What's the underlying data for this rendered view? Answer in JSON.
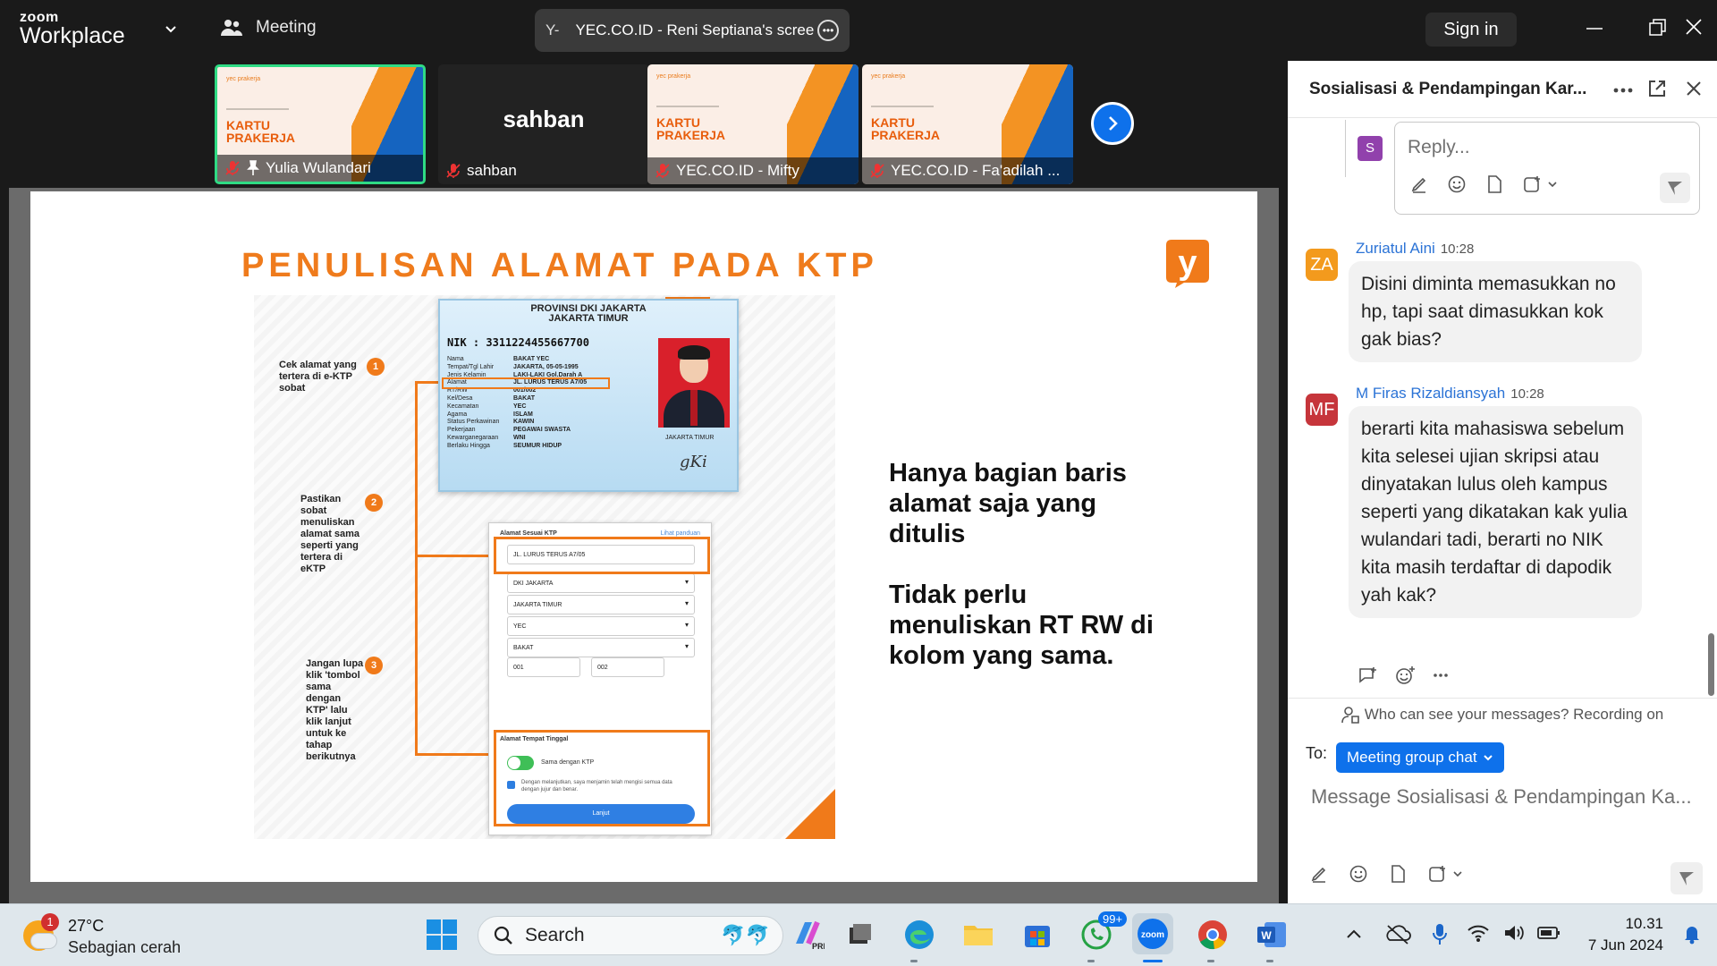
{
  "app": {
    "logo_top": "zoom",
    "logo_bottom": "Workplace",
    "meeting_label": "Meeting",
    "share_prefix": "Y-",
    "share_title": "YEC.CO.ID - Reni Septiana's scree",
    "signin": "Sign in"
  },
  "participants": [
    {
      "name": "Yulia Wulandari",
      "type": "slide",
      "active": true
    },
    {
      "name": "sahban",
      "type": "name"
    },
    {
      "name": "YEC.CO.ID - Mifty",
      "type": "slide"
    },
    {
      "name": "YEC.CO.ID - Fa'adilah ...",
      "type": "slide"
    }
  ],
  "thumb": {
    "brand": "yec prakerja",
    "title1": "KARTU",
    "title2": "PRAKERJA"
  },
  "slide": {
    "title": "PENULISAN ALAMAT PADA KTP",
    "logo": "y",
    "ktp": {
      "province": "PROVINSI DKI JAKARTA",
      "city": "JAKARTA TIMUR",
      "nik_label": "NIK",
      "nik": "3311224455667700",
      "rows": [
        [
          "Nama",
          "BAKAT YEC"
        ],
        [
          "Tempat/Tgl Lahir",
          "JAKARTA, 05-05-1995"
        ],
        [
          "Jenis Kelamin",
          "LAKI-LAKI     Gol.Darah  A"
        ],
        [
          "Alamat",
          "JL. LURUS TERUS A7/05"
        ],
        [
          "RT/RW",
          "001/002"
        ],
        [
          "Kel/Desa",
          "BAKAT"
        ],
        [
          "Kecamatan",
          "YEC"
        ],
        [
          "Agama",
          "ISLAM"
        ],
        [
          "Status Perkawinan",
          "KAWIN"
        ],
        [
          "Pekerjaan",
          "PEGAWAI SWASTA"
        ],
        [
          "Kewarganegaraan",
          "WNI"
        ],
        [
          "Berlaku Hingga",
          "SEUMUR HIDUP"
        ]
      ],
      "issue_city": "JAKARTA TIMUR",
      "signature": "gKi"
    },
    "form": {
      "heading": "Alamat Sesuai KTP",
      "link": "Lihat panduan",
      "address": "JL. LURUS TERUS A7/05",
      "province": "DKI JAKARTA",
      "city": "JAKARTA TIMUR",
      "district": "YEC",
      "village": "BAKAT",
      "rt": "001",
      "rw": "002",
      "section2": "Alamat Tempat Tinggal",
      "toggle_label": "Sama dengan KTP",
      "consent": "Dengan melanjutkan, saya menjamin telah mengisi semua data dengan jujur dan benar.",
      "button": "Lanjut"
    },
    "notes": [
      "Cek alamat yang tertera di e-KTP sobat",
      "Pastikan sobat menuliskan alamat sama seperti yang tertera di eKTP",
      "Jangan lupa klik 'tombol sama dengan KTP' lalu klik lanjut untuk ke tahap berikutnya"
    ],
    "badges": [
      "1",
      "2",
      "3"
    ],
    "right_text_1": "Hanya bagian baris alamat saja yang ditulis",
    "right_text_2": "Tidak perlu menuliskan RT RW di kolom yang sama."
  },
  "chat": {
    "title": "Sosialisasi & Pendampingan Kar...",
    "reply_avatar": "S",
    "reply_placeholder": "Reply...",
    "messages": [
      {
        "initials": "ZA",
        "color": "#f39a1d",
        "name": "Zuriatul Aini",
        "time": "10:28",
        "text": "Disini diminta memasukkan no hp, tapi saat dimasukkan kok gak bias?"
      },
      {
        "initials": "MF",
        "color": "#c6353b",
        "name": "M Firas Rizaldiansyah",
        "time": "10:28",
        "text": "berarti kita mahasiswa sebelum kita selesei ujian skripsi atau dinyatakan lulus oleh kampus seperti yang dikatakan kak yulia wulandari tadi, berarti no NIK kita masih terdaftar di dapodik yah kak?"
      }
    ],
    "privacy": "Who can see your messages? Recording on",
    "to_label": "To:",
    "to_value": "Meeting group chat",
    "input_placeholder": "Message Sosialisasi & Pendampingan Ka..."
  },
  "taskbar": {
    "temp": "27°C",
    "weather": "Sebagian cerah",
    "weather_badge": "1",
    "search": "Search",
    "whatsapp_badge": "99+",
    "zoom_label": "zoom",
    "time": "10.31",
    "date": "7 Jun 2024"
  },
  "colors": {
    "accent": "#0e71eb",
    "slide_orange": "#ef7b1c",
    "active_tile": "#2fdb84"
  }
}
